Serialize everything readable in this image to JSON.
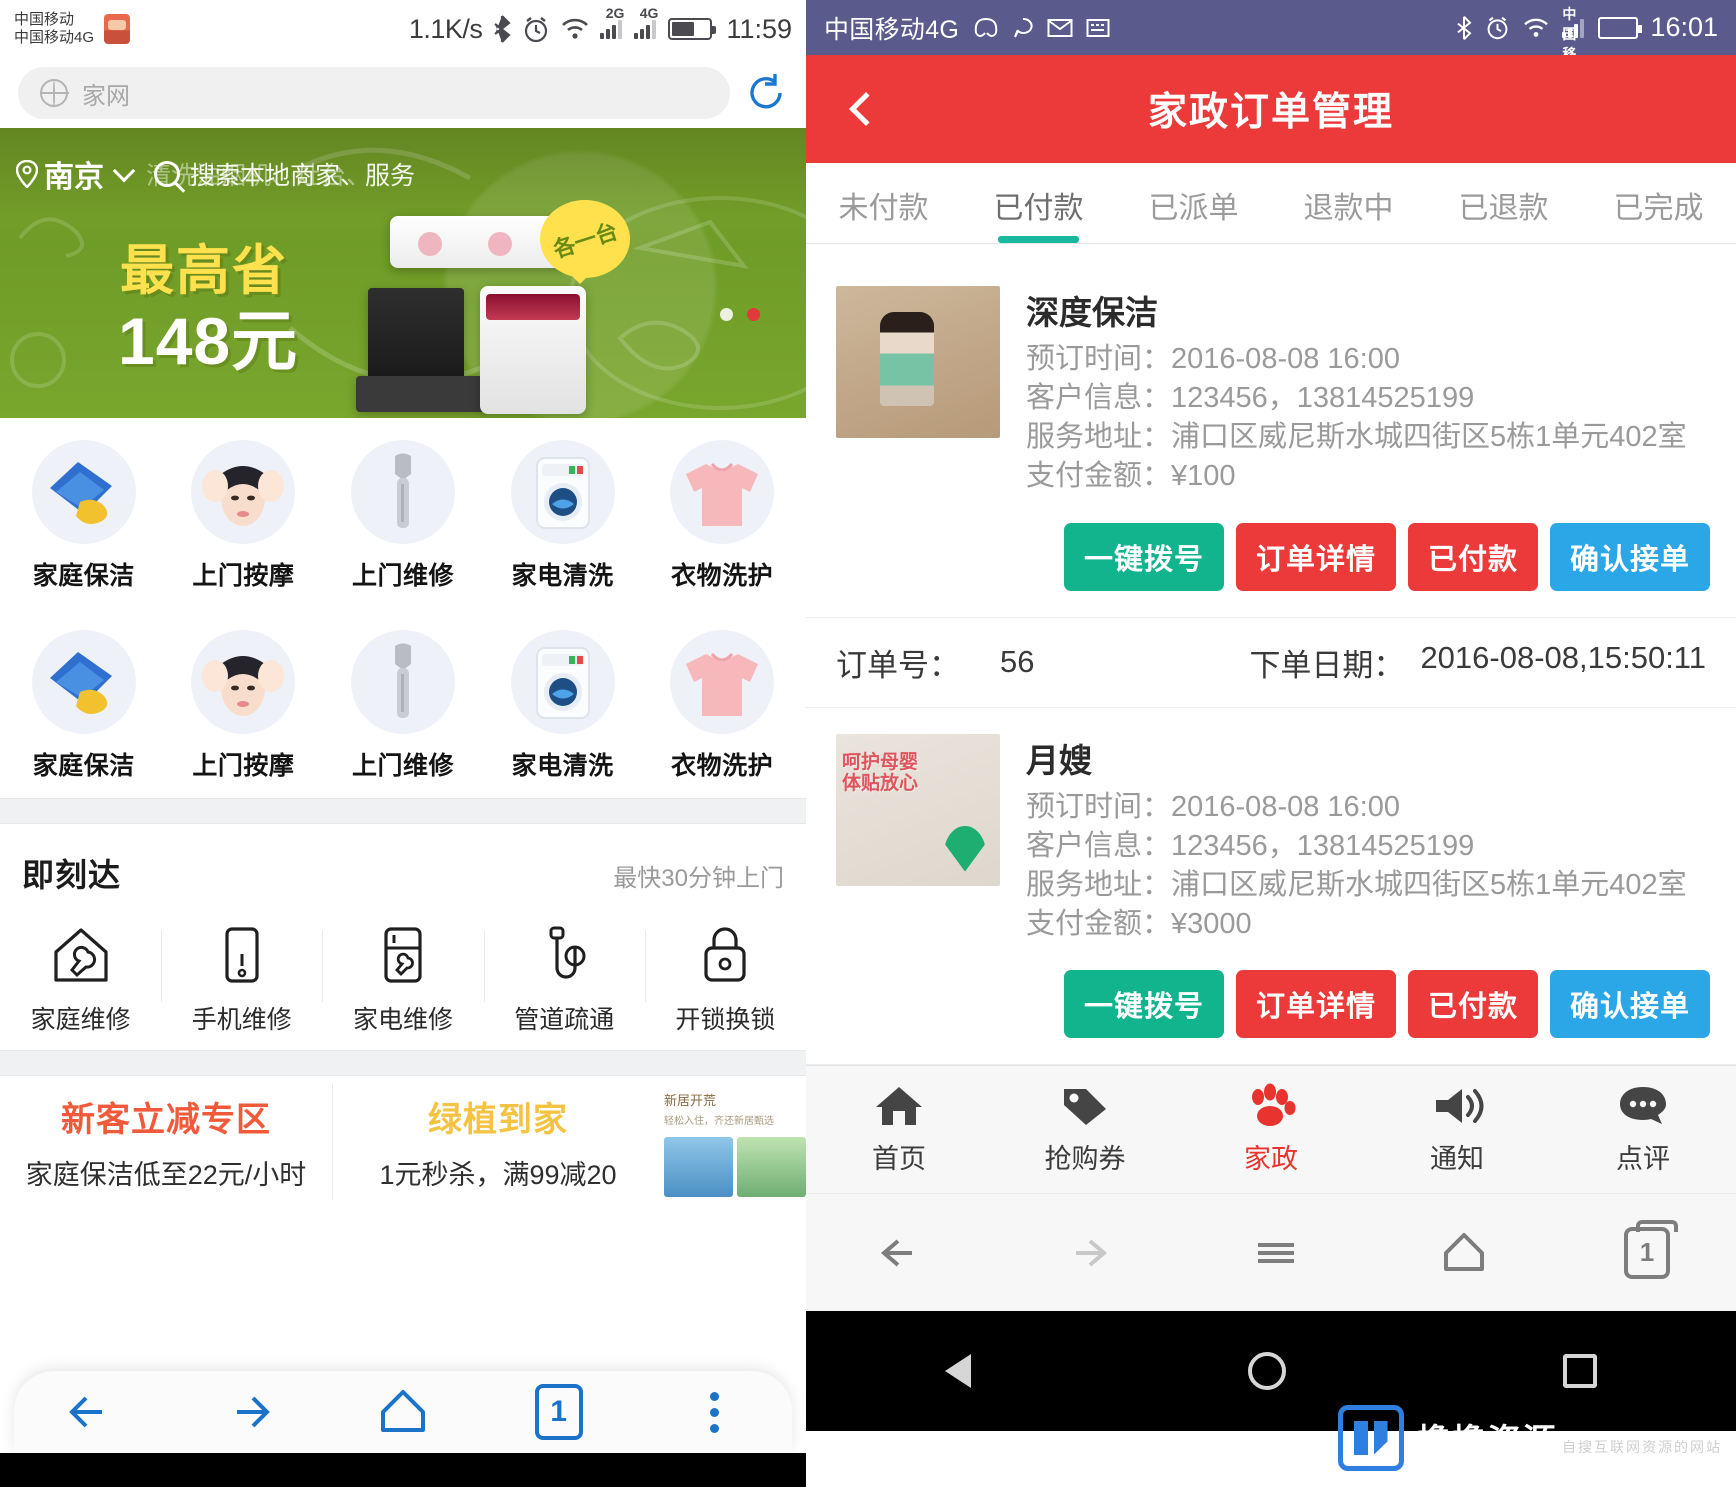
{
  "left": {
    "status": {
      "carrier_line1": "中国移动",
      "carrier_line2": "中国移动4G",
      "net_speed": "1.1K/s",
      "sim1_label": "2G",
      "sim2_label": "4G",
      "clock": "11:59"
    },
    "browser": {
      "url_text": "家网",
      "nav": {
        "tab_count": "1"
      }
    },
    "hero": {
      "city": "南京",
      "search_ghost": "清洗油烟机、灶台、",
      "search_placeholder": "搜索本地商家、服务",
      "save_label": "最高省",
      "price_label": "148元",
      "bubble_label": "各一台"
    },
    "services_row1": [
      {
        "label": "家庭保洁",
        "icon": "cleaning-cloth-icon"
      },
      {
        "label": "上门按摩",
        "icon": "massage-face-icon"
      },
      {
        "label": "上门维修",
        "icon": "wrench-icon"
      },
      {
        "label": "家电清洗",
        "icon": "washing-machine-icon"
      },
      {
        "label": "衣物洗护",
        "icon": "tshirt-icon"
      }
    ],
    "services_row2": [
      {
        "label": "家庭保洁",
        "icon": "cleaning-cloth-icon"
      },
      {
        "label": "上门按摩",
        "icon": "massage-face-icon"
      },
      {
        "label": "上门维修",
        "icon": "wrench-icon"
      },
      {
        "label": "家电清洗",
        "icon": "washing-machine-icon"
      },
      {
        "label": "衣物洗护",
        "icon": "tshirt-icon"
      }
    ],
    "instant": {
      "title": "即刻达",
      "subtitle": "最快30分钟上门",
      "items": [
        {
          "label": "家庭维修",
          "icon": "house-wrench-icon"
        },
        {
          "label": "手机维修",
          "icon": "phone-repair-icon"
        },
        {
          "label": "家电维修",
          "icon": "fridge-repair-icon"
        },
        {
          "label": "管道疏通",
          "icon": "pipe-unclog-icon"
        },
        {
          "label": "开锁换锁",
          "icon": "lock-icon"
        }
      ]
    },
    "promos": [
      {
        "title": "新客立减专区",
        "subtitle": "家庭保洁低至22元/小时"
      },
      {
        "title": "绿植到家",
        "subtitle": "1元秒杀，满99减20"
      }
    ],
    "promo_mini": {
      "line1": "新居开荒",
      "line2": "轻松入住，齐还新居甄选"
    }
  },
  "right": {
    "status": {
      "carrier": "中国移动4G",
      "clock": "16:01"
    },
    "header": {
      "title": "家政订单管理",
      "back_icon": "back-chevron-icon"
    },
    "tabs": [
      {
        "label": "未付款",
        "active": false
      },
      {
        "label": "已付款",
        "active": true
      },
      {
        "label": "已派单",
        "active": false
      },
      {
        "label": "退款中",
        "active": false
      },
      {
        "label": "已退款",
        "active": false
      },
      {
        "label": "已完成",
        "active": false
      }
    ],
    "labels": {
      "booking_time": "预订时间：",
      "customer_info": "客户信息：",
      "service_address": "服务地址：",
      "payment_amount": "支付金额：",
      "order_no": "订单号：",
      "order_date": "下单日期："
    },
    "orders": [
      {
        "name": "深度保洁",
        "booking_time": "2016-08-08 16:00",
        "customer_info": "123456，13814525199",
        "service_address": "浦口区威尼斯水城四街区5栋1单元402室",
        "payment_amount": "¥100",
        "thumb": "deep-cleaning-photo",
        "buttons": [
          {
            "label": "一键拨号",
            "color": "#12b48e"
          },
          {
            "label": "订单详情",
            "color": "#ec3a3a"
          },
          {
            "label": "已付款",
            "color": "#ec3a3a"
          },
          {
            "label": "确认接单",
            "color": "#2ba7e8"
          }
        ]
      },
      {
        "name": "月嫂",
        "booking_time": "2016-08-08 16:00",
        "customer_info": "123456，13814525199",
        "service_address": "浦口区威尼斯水城四街区5栋1单元402室",
        "payment_amount": "¥3000",
        "thumb": "nanny-photo",
        "thumb_text": "呵护母婴\n体贴放心",
        "buttons": [
          {
            "label": "一键拨号",
            "color": "#12b48e"
          },
          {
            "label": "订单详情",
            "color": "#ec3a3a"
          },
          {
            "label": "已付款",
            "color": "#ec3a3a"
          },
          {
            "label": "确认接单",
            "color": "#2ba7e8"
          }
        ]
      }
    ],
    "order_meta": {
      "order_no_value": "56",
      "order_date_value": "2016-08-08,15:50:11"
    },
    "tabbar": [
      {
        "label": "首页",
        "icon": "home-icon",
        "active": false
      },
      {
        "label": "抢购券",
        "icon": "tag-icon",
        "active": false
      },
      {
        "label": "家政",
        "icon": "paw-icon",
        "active": true
      },
      {
        "label": "通知",
        "icon": "megaphone-icon",
        "active": false
      },
      {
        "label": "点评",
        "icon": "comment-icon",
        "active": false
      }
    ],
    "sysnav": {
      "tab_count": "1"
    },
    "navbar_icons": [
      "back-triangle-icon",
      "home-circle-icon",
      "recent-square-icon"
    ]
  },
  "watermark": {
    "name": "撸撸资源",
    "tagline": "自搜互联网资源的网站",
    "registered": "®"
  },
  "colors": {
    "brand_red": "#ec3a3a",
    "tab_active": "#19b9a0",
    "btn_teal": "#12b48e",
    "btn_blue": "#2ba7e8",
    "status_purple": "#5a5a8c",
    "hero_green": "#7aa32a"
  }
}
